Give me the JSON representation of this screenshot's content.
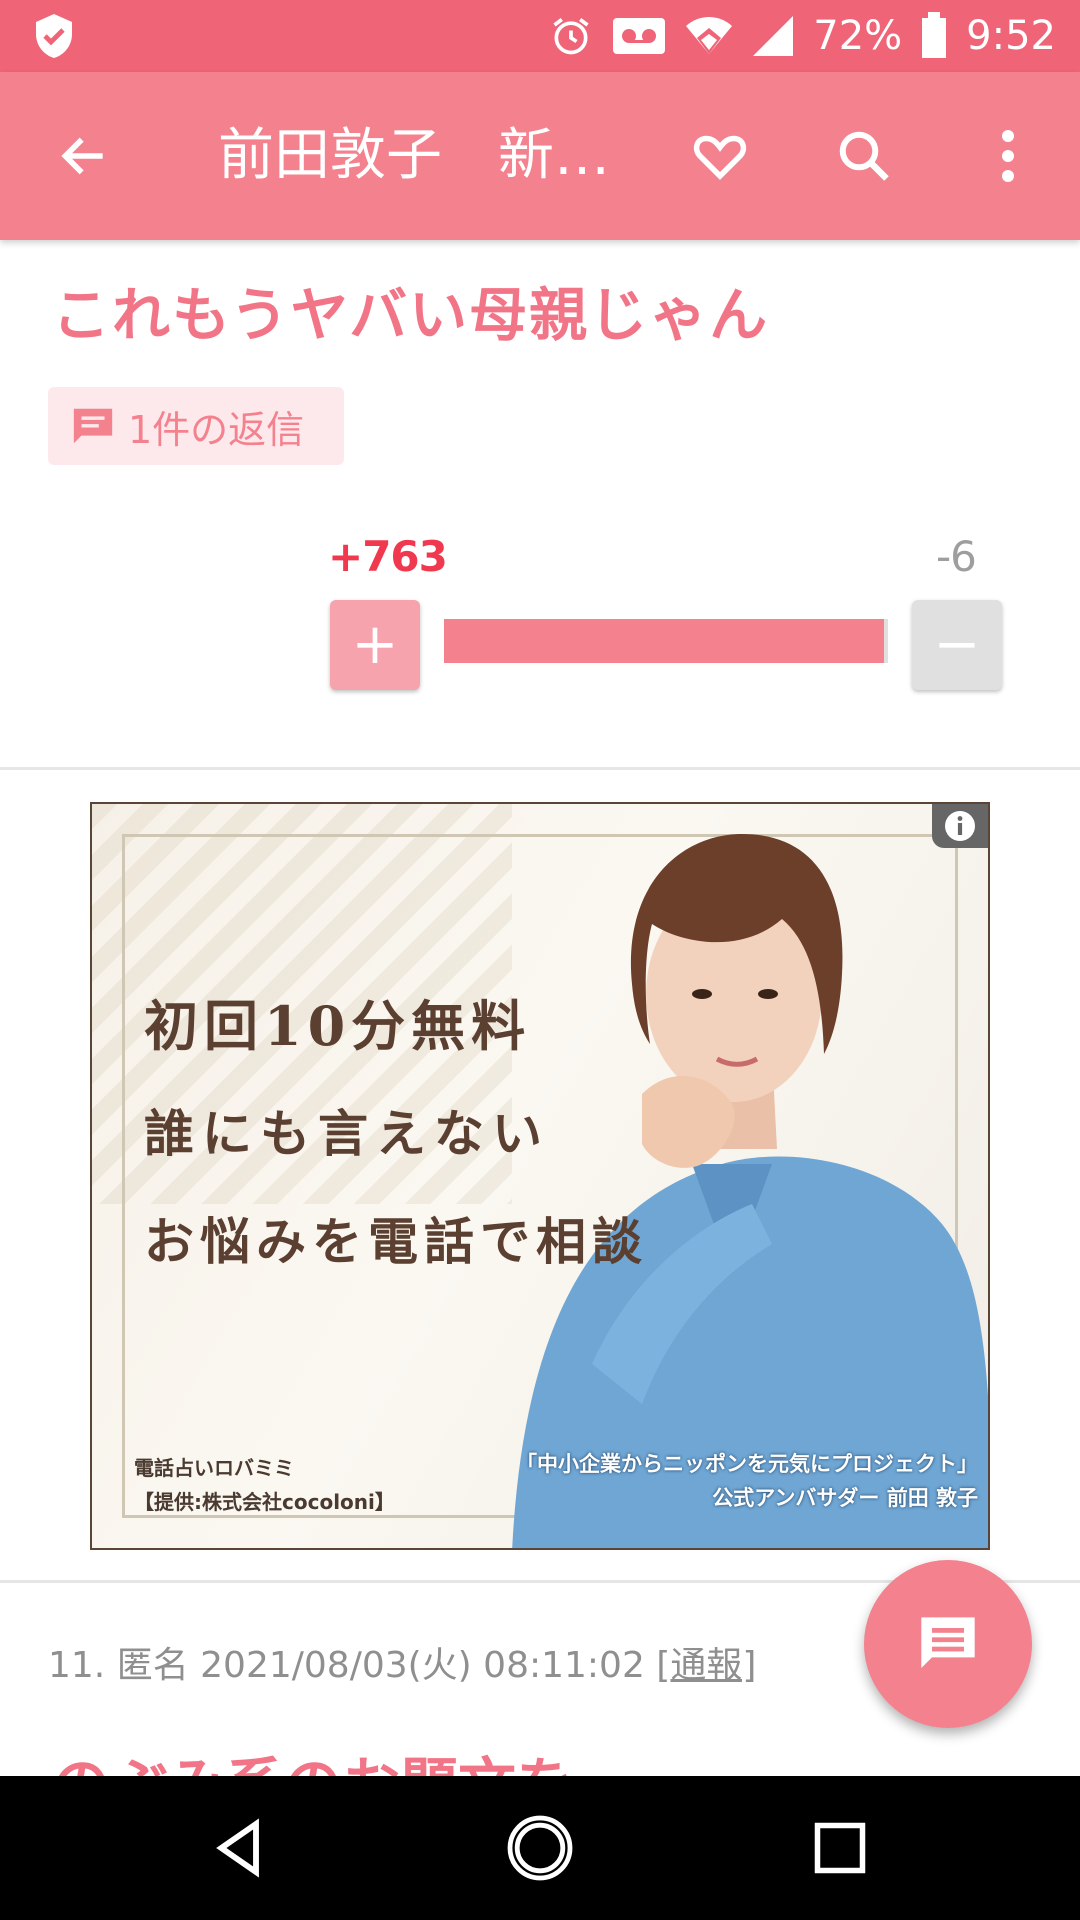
{
  "status_bar": {
    "battery": "72%",
    "time": "9:52"
  },
  "app_bar": {
    "title": "前田敦子　新…"
  },
  "post": {
    "title": "これもうヤバい母親じゃん",
    "reply_label": "1件の返信",
    "plus_count": "+763",
    "minus_count": "-6",
    "plus_symbol": "+",
    "minus_symbol": "−",
    "vote_ratio": 0.992
  },
  "ad": {
    "line1": "初回10分無料",
    "line2": "誰にも言えない",
    "line3": "お悩みを電話で相談",
    "brand_name": "電話占いロバミミ",
    "brand_provider": "【提供:株式会社cocoloni】",
    "caption1": "「中小企業からニッポンを元気にプロジェクト」",
    "caption2": "公式アンバサダー 前田 敦子"
  },
  "next_comment": {
    "meta": "11. 匿名 2021/08/03(火) 08:11:02 ",
    "report_label": "[通報]",
    "title_partial": "のぶみ系のお題文を"
  },
  "icons": {
    "status": [
      "shield-check-icon",
      "alarm-icon",
      "voicemail-icon",
      "wifi-icon",
      "signal-icon",
      "battery-icon"
    ],
    "app_bar": [
      "back-arrow-icon",
      "heart-icon",
      "search-icon",
      "more-vert-icon"
    ],
    "nav": [
      "back-triangle-icon",
      "home-circle-icon",
      "recents-square-icon"
    ]
  },
  "colors": {
    "primary": "#f4828e",
    "status": "#ef6577",
    "plus": "#f0394f"
  }
}
